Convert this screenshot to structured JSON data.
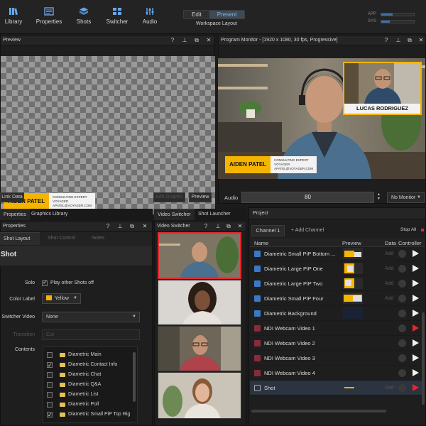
{
  "toolbar": {
    "items": [
      {
        "label": "Library",
        "icon": "library-icon"
      },
      {
        "label": "Properties",
        "icon": "properties-icon"
      },
      {
        "label": "Shots",
        "icon": "shots-icon"
      },
      {
        "label": "Switcher",
        "icon": "switcher-icon"
      },
      {
        "label": "Audio",
        "icon": "audio-icon"
      }
    ],
    "workspace": {
      "edit": "Edit",
      "present": "Present",
      "caption": "Workspace Layout"
    },
    "meters": [
      {
        "label": "APP",
        "level": 0.35
      },
      {
        "label": "SYS",
        "level": 0.25
      }
    ]
  },
  "preview": {
    "title": "Preview",
    "lower_third": {
      "name": "AIDEN PATEL",
      "line1": "CONSULTING EXPERT",
      "line2": "VOYAGER",
      "line3": "APATEL@VOYAGER.COM"
    },
    "buttons": {
      "link": "Link Data",
      "edit": "Edit Graphic",
      "preview": "Preview"
    }
  },
  "program": {
    "title": "Program Monitor - [1920 x 1080, 30 fps, Progressive]",
    "pip_name": "LUCAS RODRIGUEZ",
    "lower_third": {
      "name": "AIDEN PATEL",
      "line1": "CONSULTING EXPERT",
      "line2": "VOYAGER",
      "line3": "APATEL@VOYAGER.COM"
    },
    "audio_label": "Audio",
    "audio_value": "80",
    "monitor_select": "No Monitor"
  },
  "properties": {
    "tabs": [
      "Properties",
      "Graphics Library"
    ],
    "subheader": "Properties",
    "shot_tabs": [
      "Shot Layout",
      "Shot Control",
      "Notes"
    ],
    "heading": "Shot",
    "solo_label": "Solo",
    "solo_text": "Play other Shots off",
    "color_label": "Color Label",
    "color_value": "Yellow",
    "switcher_label": "Switcher Video",
    "switcher_value": "None",
    "transition_label": "Transition",
    "transition_value": "Cut",
    "contents_label": "Contents",
    "contents": [
      {
        "label": "Diametric Main",
        "checked": false
      },
      {
        "label": "Diametric Contact Info",
        "checked": true
      },
      {
        "label": "Diametric Chat",
        "checked": false
      },
      {
        "label": "Diametric Q&A",
        "checked": false
      },
      {
        "label": "Diametric List",
        "checked": false
      },
      {
        "label": "Diametric Poll",
        "checked": false
      },
      {
        "label": "Diametric Small PiP Top Rig",
        "checked": true
      }
    ]
  },
  "switcher": {
    "tabs": [
      "Video Switcher",
      "Shot Launcher"
    ],
    "subheader": "Video Switcher"
  },
  "project": {
    "title": "Project",
    "channel_tab": "Channel 1",
    "add_channel": "+ Add Channel",
    "stop_all": "Stop All",
    "columns": {
      "name": "Name",
      "preview": "Preview",
      "data": "Data",
      "controller": "Controller"
    },
    "rows": [
      {
        "name": "Diametric Small PiP Bottom ...",
        "kind": "graphic",
        "add": "Add",
        "play": "white"
      },
      {
        "name": "Diametric Large PiP One",
        "kind": "graphic",
        "add": "Add",
        "play": "white"
      },
      {
        "name": "Diametric Large PiP Two",
        "kind": "graphic",
        "add": "Add",
        "play": "white"
      },
      {
        "name": "Diametric Small PiP Four",
        "kind": "graphic",
        "add": "Add",
        "play": "white"
      },
      {
        "name": "Diametric Background",
        "kind": "graphic",
        "add": "",
        "play": "white"
      },
      {
        "name": "NDI Webcam Video 1",
        "kind": "ndi",
        "add": "",
        "play": "red"
      },
      {
        "name": "NDI Webcam Video 2",
        "kind": "ndi",
        "add": "",
        "play": "white"
      },
      {
        "name": "NDI Webcam Video 3",
        "kind": "ndi",
        "add": "",
        "play": "white"
      },
      {
        "name": "NDI Webcam Video 4",
        "kind": "ndi",
        "add": "",
        "play": "white"
      },
      {
        "name": "Shot",
        "kind": "shot",
        "add": "Add",
        "play": "red"
      }
    ]
  },
  "colors": {
    "accent": "#f5b400",
    "live": "#e0282e",
    "present": "#7fb4e8"
  }
}
